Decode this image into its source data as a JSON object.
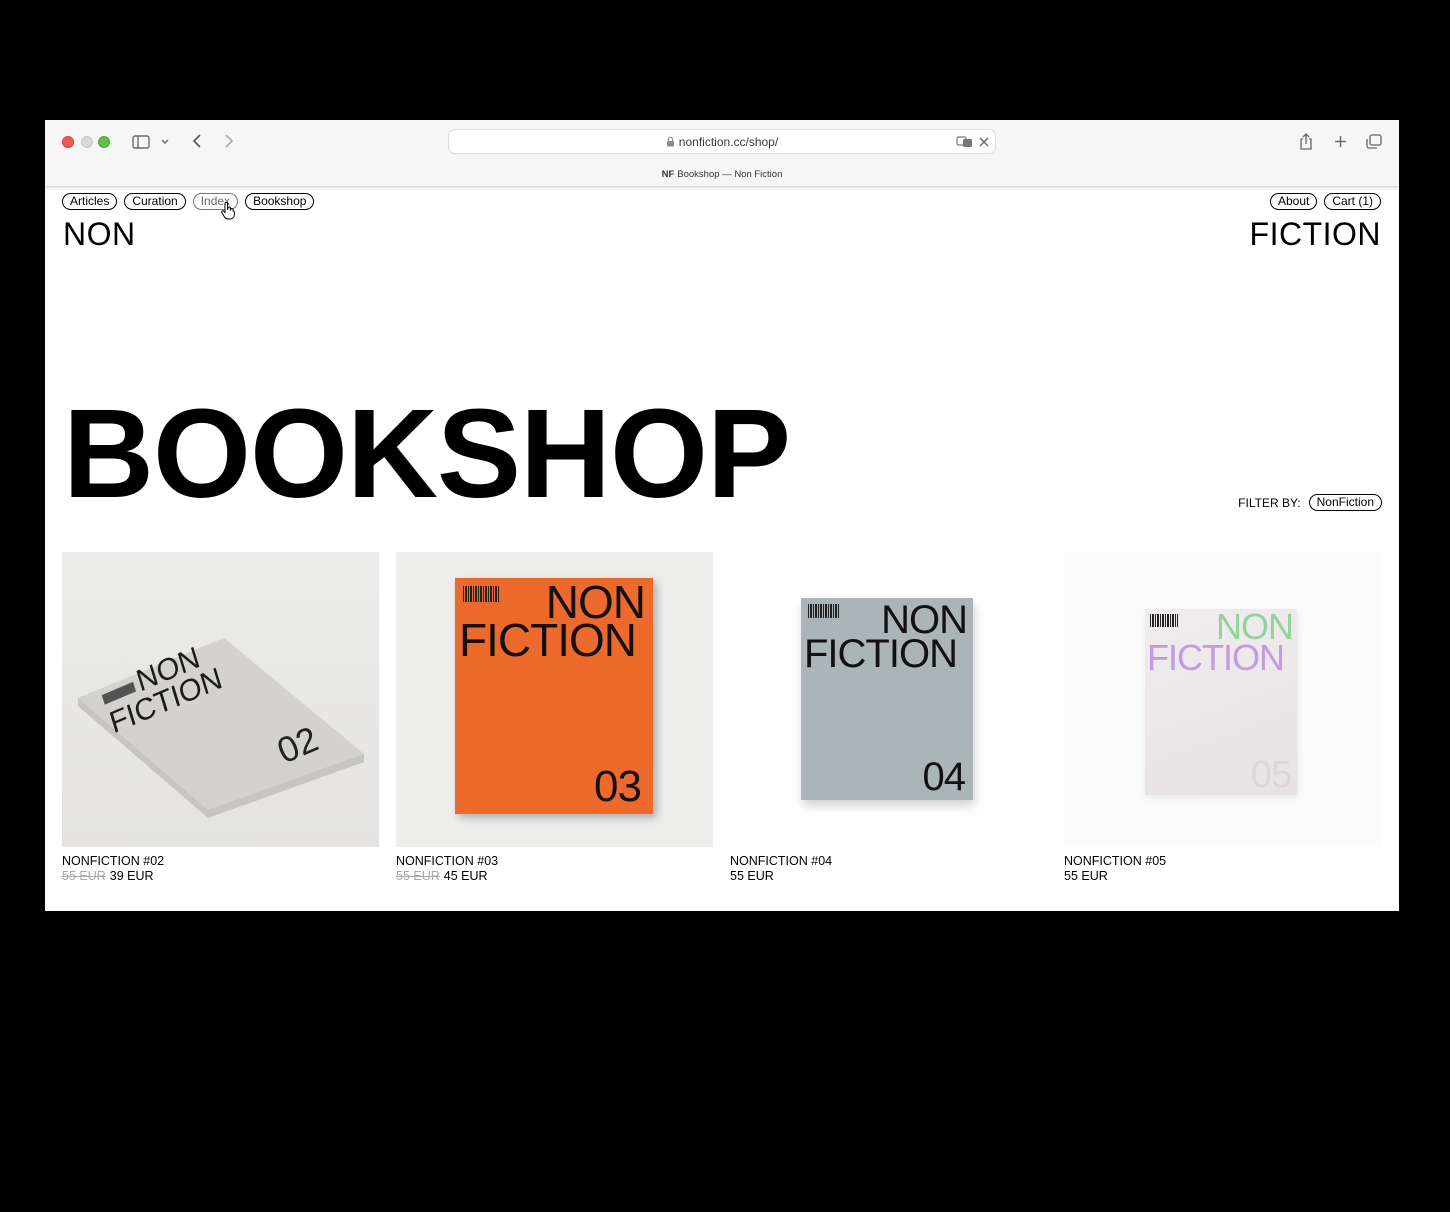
{
  "browser": {
    "url": "nonfiction.cc/shop/",
    "tab_favicon": "NF",
    "tab_title": "Bookshop — Non Fiction"
  },
  "nav": {
    "left": [
      "Articles",
      "Curation",
      "Index",
      "Bookshop"
    ],
    "right": [
      "About",
      "Cart (1)"
    ]
  },
  "brand": {
    "left": "NON",
    "right": "FICTION"
  },
  "hero_title": "BOOKSHOP",
  "filter": {
    "label": "FILTER BY:",
    "value": "NonFiction"
  },
  "products": [
    {
      "name": "NONFICTION #02",
      "old_price": "55 EUR",
      "price": "39 EUR",
      "cover_color": "#d4d2cf",
      "issue": "02"
    },
    {
      "name": "NONFICTION #03",
      "old_price": "55 EUR",
      "price": "45 EUR",
      "cover_color": "#ee6a2b",
      "issue": "03"
    },
    {
      "name": "NONFICTION #04",
      "old_price": "",
      "price": "55 EUR",
      "cover_color": "#a9b5b7",
      "issue": "04"
    },
    {
      "name": "NONFICTION #05",
      "old_price": "",
      "price": "55 EUR",
      "cover_color": "#ebe6e8",
      "issue": "05"
    }
  ],
  "cover_text": {
    "line1": "NON",
    "line2": "FICTION"
  },
  "colors": {
    "traffic_red": "#ee5a52",
    "traffic_green": "#5fc246",
    "orange_cover": "#ee6a2b"
  }
}
